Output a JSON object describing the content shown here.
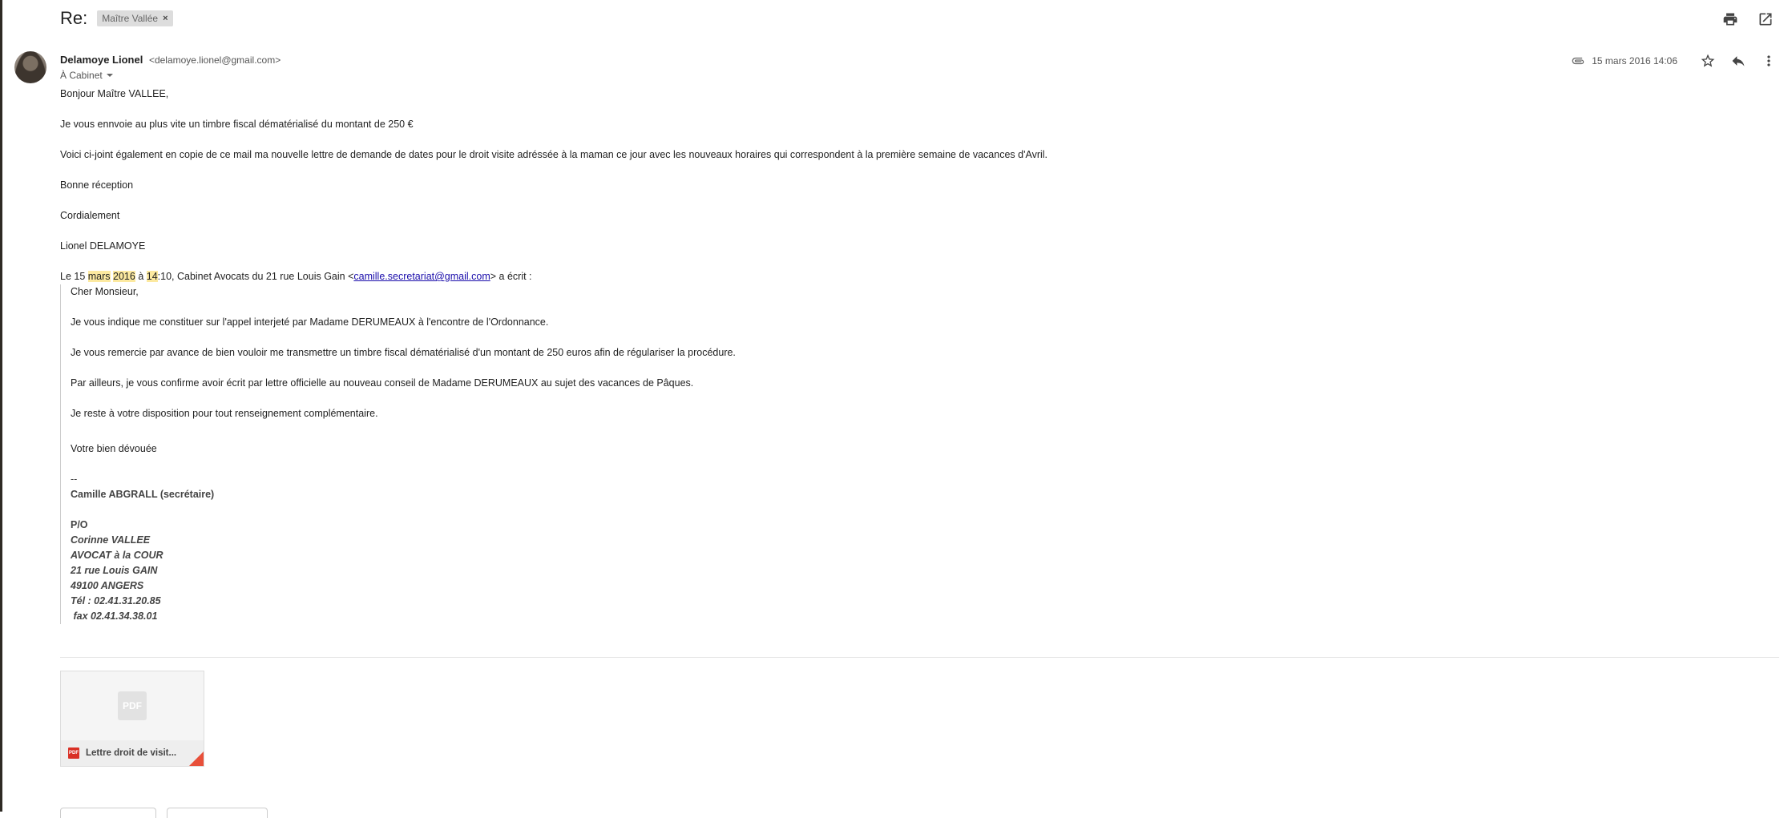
{
  "subject": "Re:",
  "label_chip": {
    "text": "Maître Vallée",
    "remove": "×"
  },
  "sender": {
    "name": "Delamoye Lionel",
    "email": "<delamoye.lionel@gmail.com>",
    "recipient": "À Cabinet"
  },
  "date": "15 mars 2016 14:06",
  "icons": {
    "print": "print-icon",
    "open_new": "open-in-new-window-icon",
    "attachment": "paperclip-icon",
    "star": "star-icon",
    "reply": "reply-icon",
    "more": "more-vert-icon",
    "pdf": "pdf-icon"
  },
  "body": {
    "greeting": "Bonjour Maître VALLEE,",
    "p1": "Je vous ennvoie au plus vite un timbre fiscal dématérialisé du montant de 250 €",
    "p2": "Voici ci-joint également en copie de ce mail ma nouvelle lettre de demande de dates pour le droit visite adréssée à la maman ce jour avec les nouveaux horaires qui correspondent à la première semaine de vacances d'Avril.",
    "p3": "Bonne réception",
    "p4": "Cordialement",
    "p5": "Lionel DELAMOYE"
  },
  "quote_header": {
    "prefix": "Le 15 ",
    "hl1": "mars",
    "sp1": " ",
    "hl2": "2016",
    "mid": " à ",
    "hl3": "14",
    "suffix": ":10, Cabinet Avocats du 21 rue Louis Gain <",
    "email": "camille.secretariat@gmail.com",
    "end": "> a écrit :"
  },
  "quoted": {
    "q1": "Cher Monsieur,",
    "q2": "Je vous indique me constituer sur l'appel interjeté par Madame DERUMEAUX à l'encontre de l'Ordonnance.",
    "q3": "Je vous remercie par avance de bien vouloir me transmettre un timbre fiscal dématérialisé d'un montant de 250 euros afin de régulariser la procédure.",
    "q4": "Par ailleurs, je vous confirme avoir écrit par lettre officielle au nouveau conseil de Madame DERUMEAUX au sujet des vacances de Pâques.",
    "q5": "Je reste à votre disposition pour tout renseignement complémentaire.",
    "q6": "Votre bien dévouée"
  },
  "signature": {
    "dashes": "--",
    "name": "Camille ABGRALL (secrétaire)",
    "po": "P/O",
    "l1": "Corinne VALLEE",
    "l2": "AVOCAT à la COUR",
    "l3": "21 rue Louis GAIN",
    "l4": "49100 ANGERS",
    "l5": "Tél : 02.41.31.20.85",
    "l6": " fax 02.41.34.38.01"
  },
  "attachment": {
    "preview_label": "PDF",
    "badge": "PDF",
    "name": "Lettre droit de visit..."
  }
}
